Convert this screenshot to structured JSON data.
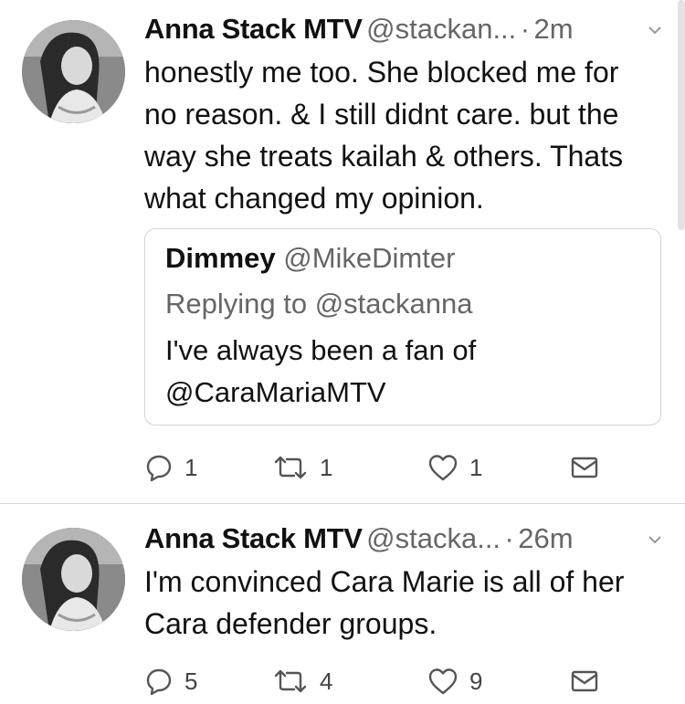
{
  "tweets": [
    {
      "name": "Anna Stack MTV",
      "handle": "@stackan...",
      "separator": "·",
      "time": "2m",
      "text_lines": [
        "honestly me too. She blocked me for",
        "no reason. & I still didnt care. but the",
        "way she treats kailah & others. Thats",
        "what changed my opinion."
      ],
      "quote": {
        "name": "Dimmey",
        "handle": "@MikeDimter",
        "replying": "Replying to @stackanna",
        "text_lines": [
          "I've always been a fan of",
          "@CaraMariaMTV"
        ]
      },
      "replies": "1",
      "retweets": "1",
      "likes": "1"
    },
    {
      "name": "Anna Stack MTV",
      "handle": "@stacka...",
      "separator": "·",
      "time": "26m",
      "text_lines": [
        "I'm convinced Cara Marie is all of her",
        "Cara defender groups."
      ],
      "replies": "5",
      "retweets": "4",
      "likes": "9"
    }
  ],
  "icons": {
    "reply": "reply-icon",
    "retweet": "retweet-icon",
    "like": "heart-icon",
    "dm": "envelope-icon",
    "more": "chevron-down-icon"
  },
  "colors": {
    "text": "#111111",
    "muted": "#666666",
    "border": "#d3d3d3"
  }
}
